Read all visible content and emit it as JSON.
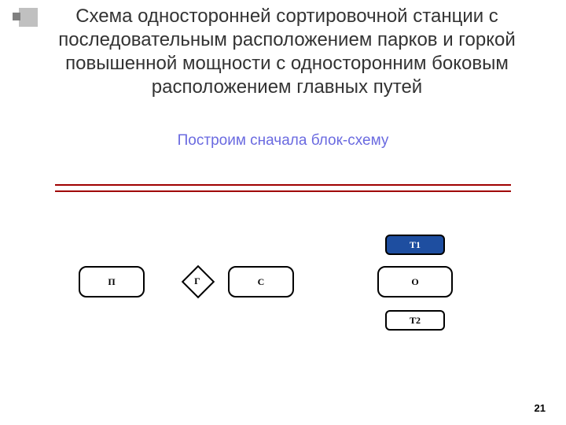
{
  "title": "Схема односторонней сортировочной станции с последовательным расположением парков и горкой повышенной мощности с односторонним боковым расположением главных путей",
  "subtitle": "Построим сначала  блок-схему",
  "page_number": "21",
  "blocks": {
    "p": "П",
    "g": "Г",
    "c": "С",
    "t1": "Т1",
    "o": "О",
    "t2": "Т2"
  }
}
